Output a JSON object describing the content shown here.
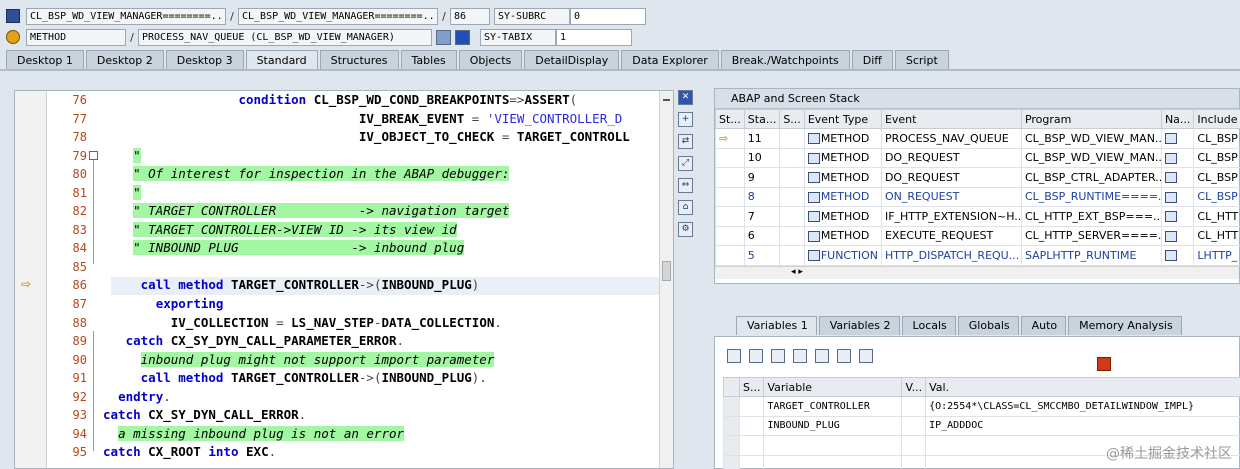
{
  "header": {
    "row1": {
      "field1": "CL_BSP_WD_VIEW_MANAGER========...",
      "field2": "CL_BSP_WD_VIEW_MANAGER========...",
      "line": "86",
      "var_name": "SY-SUBRC",
      "var_value": "0"
    },
    "row2": {
      "field1": "METHOD",
      "field2": "PROCESS_NAV_QUEUE (CL_BSP_WD_VIEW_MANAGER)",
      "var_name": "SY-TABIX",
      "var_value": "1"
    },
    "separator": "/"
  },
  "tabs": [
    "Desktop 1",
    "Desktop 2",
    "Desktop 3",
    "Standard",
    "Structures",
    "Tables",
    "Objects",
    "DetailDisplay",
    "Data Explorer",
    "Break./Watchpoints",
    "Diff",
    "Script"
  ],
  "active_tab": "Standard",
  "editor": {
    "lines": [
      {
        "n": "76",
        "segs": [
          [
            "",
            "                  "
          ],
          [
            "kw",
            "condition "
          ],
          [
            "bold",
            "CL_BSP_WD_COND_BREAKPOINTS"
          ],
          [
            "op",
            "=>"
          ],
          [
            "bold",
            "ASSERT"
          ],
          [
            "op",
            "("
          ]
        ]
      },
      {
        "n": "77",
        "segs": [
          [
            "",
            "                                  "
          ],
          [
            "bold",
            "IV_BREAK_EVENT"
          ],
          [
            "op",
            " = "
          ],
          [
            "str",
            "'VIEW_CONTROLLER_D"
          ]
        ]
      },
      {
        "n": "78",
        "segs": [
          [
            "",
            "                                  "
          ],
          [
            "bold",
            "IV_OBJECT_TO_CHECK"
          ],
          [
            "op",
            " = "
          ],
          [
            "bold",
            "TARGET_CONTROLL"
          ]
        ]
      },
      {
        "n": "79",
        "segs": [
          [
            "",
            "    "
          ],
          [
            "cmt",
            "\""
          ]
        ]
      },
      {
        "n": "80",
        "segs": [
          [
            "",
            "    "
          ],
          [
            "cmt",
            "\" Of interest for inspection in the ABAP debugger:"
          ]
        ]
      },
      {
        "n": "81",
        "segs": [
          [
            "",
            "    "
          ],
          [
            "cmt",
            "\""
          ]
        ]
      },
      {
        "n": "82",
        "segs": [
          [
            "",
            "    "
          ],
          [
            "cmt",
            "\" TARGET CONTROLLER           -> navigation target"
          ]
        ]
      },
      {
        "n": "83",
        "segs": [
          [
            "",
            "    "
          ],
          [
            "cmt",
            "\" TARGET CONTROLLER->VIEW ID -> its view id"
          ]
        ]
      },
      {
        "n": "84",
        "segs": [
          [
            "",
            "    "
          ],
          [
            "cmt",
            "\" INBOUND PLUG               -> inbound plug"
          ]
        ]
      },
      {
        "n": "85",
        "segs": [
          [
            "",
            ""
          ]
        ]
      },
      {
        "n": "86",
        "segs": [
          [
            "",
            "     "
          ],
          [
            "kw",
            "call method "
          ],
          [
            "bold",
            "TARGET_CONTROLLER"
          ],
          [
            "op",
            "->("
          ],
          [
            "bold",
            "INBOUND_PLUG"
          ],
          [
            "op",
            ")"
          ]
        ]
      },
      {
        "n": "87",
        "segs": [
          [
            "",
            "       "
          ],
          [
            "kw",
            "exporting"
          ]
        ]
      },
      {
        "n": "88",
        "segs": [
          [
            "",
            "         "
          ],
          [
            "bold",
            "IV_COLLECTION"
          ],
          [
            "op",
            " = "
          ],
          [
            "bold",
            "LS_NAV_STEP"
          ],
          [
            "op",
            "-"
          ],
          [
            "bold",
            "DATA_COLLECTION"
          ],
          [
            "op",
            "."
          ]
        ]
      },
      {
        "n": "89",
        "segs": [
          [
            "",
            "   "
          ],
          [
            "kw",
            "catch "
          ],
          [
            "bold",
            "CX_SY_DYN_CALL_PARAMETER_ERROR"
          ],
          [
            "op",
            "."
          ]
        ]
      },
      {
        "n": "90",
        "segs": [
          [
            "",
            "     "
          ],
          [
            "cmt",
            "inbound plug might not support import parameter"
          ]
        ]
      },
      {
        "n": "91",
        "segs": [
          [
            "",
            "     "
          ],
          [
            "kw",
            "call method "
          ],
          [
            "bold",
            "TARGET_CONTROLLER"
          ],
          [
            "op",
            "->("
          ],
          [
            "bold",
            "INBOUND_PLUG"
          ],
          [
            "op",
            ")."
          ]
        ]
      },
      {
        "n": "92",
        "segs": [
          [
            "",
            "  "
          ],
          [
            "kw",
            "endtry"
          ],
          [
            "op",
            "."
          ]
        ]
      },
      {
        "n": "93",
        "segs": [
          [
            "kw",
            "catch "
          ],
          [
            "bold",
            "CX_SY_DYN_CALL_ERROR"
          ],
          [
            "op",
            "."
          ]
        ]
      },
      {
        "n": "94",
        "segs": [
          [
            "",
            "  "
          ],
          [
            "cmt",
            "a missing inbound plug is not an error"
          ]
        ]
      },
      {
        "n": "95",
        "segs": [
          [
            "kw",
            "catch "
          ],
          [
            "bold",
            "CX_ROOT "
          ],
          [
            "kw",
            "into "
          ],
          [
            "bold",
            "EXC"
          ],
          [
            "op",
            "."
          ]
        ]
      }
    ]
  },
  "stack": {
    "title": "ABAP and Screen Stack",
    "columns": [
      "St...",
      "Sta...",
      "S...",
      "Event Type",
      "Event",
      "Program",
      "Na...",
      "Include"
    ],
    "rows": [
      {
        "st": "⇨",
        "sta": "11",
        "type": "METHOD",
        "event": "PROCESS_NAV_QUEUE",
        "program": "CL_BSP_WD_VIEW_MAN...",
        "include": "CL_BSP",
        "blue": false
      },
      {
        "st": "",
        "sta": "10",
        "type": "METHOD",
        "event": "DO_REQUEST",
        "program": "CL_BSP_WD_VIEW_MAN...",
        "include": "CL_BSP",
        "blue": false
      },
      {
        "st": "",
        "sta": "9",
        "type": "METHOD",
        "event": "DO_REQUEST",
        "program": "CL_BSP_CTRL_ADAPTER...",
        "include": "CL_BSP",
        "blue": false
      },
      {
        "st": "",
        "sta": "8",
        "type": "METHOD",
        "event": "ON_REQUEST",
        "program": "CL_BSP_RUNTIME====...",
        "include": "CL_BSP",
        "blue": true
      },
      {
        "st": "",
        "sta": "7",
        "type": "METHOD",
        "event": "IF_HTTP_EXTENSION~H...",
        "program": "CL_HTTP_EXT_BSP===...",
        "include": "CL_HTT",
        "blue": false
      },
      {
        "st": "",
        "sta": "6",
        "type": "METHOD",
        "event": "EXECUTE_REQUEST",
        "program": "CL_HTTP_SERVER====...",
        "include": "CL_HTT",
        "blue": false
      },
      {
        "st": "",
        "sta": "5",
        "type": "FUNCTION",
        "event": "HTTP_DISPATCH_REQU...",
        "program": "SAPLHTTP_RUNTIME",
        "include": "LHTTP_",
        "blue": true
      }
    ]
  },
  "var_tabs": [
    "Variables 1",
    "Variables 2",
    "Locals",
    "Globals",
    "Auto",
    "Memory Analysis"
  ],
  "variables": {
    "columns": [
      "S...",
      "Variable",
      "V...",
      "Val."
    ],
    "rows": [
      {
        "name": "TARGET_CONTROLLER",
        "value": "{O:2554*\\CLASS=CL_SMCCMBO_DETAILWINDOW_IMPL}"
      },
      {
        "name": "INBOUND_PLUG",
        "value": "IP_ADDDOC"
      }
    ]
  },
  "watermark": "@稀土掘金技术社区"
}
